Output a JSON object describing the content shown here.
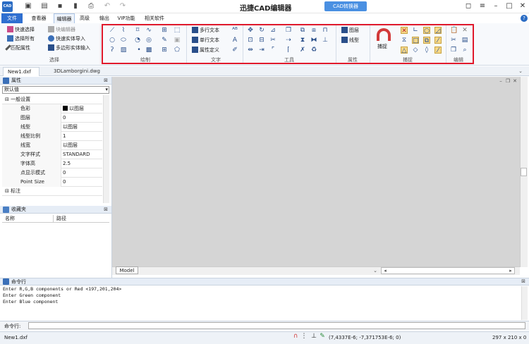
{
  "app": {
    "title": "迅捷CAD编辑器",
    "converter_label": "CAD转换器"
  },
  "menu_tabs": [
    "文件",
    "查看器",
    "编辑器",
    "高级",
    "输出",
    "VIP功能",
    "相关软件"
  ],
  "ribbon": {
    "select_group": {
      "label": "选择",
      "items": [
        "快速选择",
        "选择所有",
        "匹配属性",
        "块编辑器",
        "快速实体导入",
        "多边形实体输入"
      ]
    },
    "draw_group": {
      "label": "绘制"
    },
    "text_group": {
      "label": "文字",
      "items": [
        "多行文本",
        "单行文本",
        "属性定义"
      ]
    },
    "tools_group": {
      "label": "工具"
    },
    "properties_group": {
      "label": "属性",
      "items": [
        "图层",
        "线型"
      ]
    },
    "snap_group": {
      "label": "捕捉",
      "snap_label": "捕捉"
    },
    "edit_group": {
      "label": "编辑"
    }
  },
  "doc_tabs": [
    "New1.dxf",
    "3DLamborgini.dwg"
  ],
  "properties_panel": {
    "title": "属性",
    "selected": "默认值",
    "category": "一般设置",
    "rows": [
      {
        "name": "色彩",
        "value": "以图层"
      },
      {
        "name": "图层",
        "value": "0"
      },
      {
        "name": "线型",
        "value": "以图层"
      },
      {
        "name": "线型比例",
        "value": "1"
      },
      {
        "name": "线宽",
        "value": "以图层"
      },
      {
        "name": "文字样式",
        "value": "STANDARD"
      },
      {
        "name": "字体高",
        "value": "2.5"
      },
      {
        "name": "点显示模式",
        "value": "0"
      },
      {
        "name": "Point Size",
        "value": "0"
      }
    ],
    "category2": "标注"
  },
  "favorites_panel": {
    "title": "收藏夹",
    "col_name": "名称",
    "col_path": "路径"
  },
  "canvas": {
    "model_tab": "Model"
  },
  "command": {
    "title": "命令行",
    "log": [
      "Enter R,G,B components or Red <197,201,204>",
      "Enter Green component",
      "Enter Blue component"
    ],
    "prompt": "命令行:"
  },
  "status": {
    "file": "New1.dxf",
    "coords": "(7,4337E-6; -7,371753E-6; 0)",
    "paper": "297 x 210 x 0"
  },
  "colors": {
    "accent": "#2f6fd0",
    "highlight": "#e0192b",
    "canvas": "#d5d5d5"
  }
}
